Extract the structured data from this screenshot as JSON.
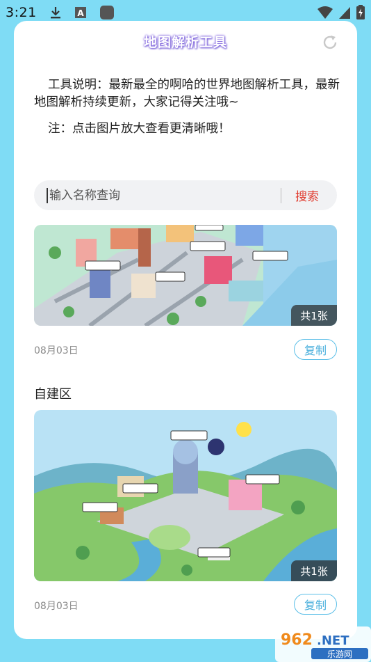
{
  "status": {
    "time": "3:21"
  },
  "header": {
    "title": "地图解析工具"
  },
  "description": {
    "intro": "工具说明：最新最全的啊哈的世界地图解析工具，最新地图解析持续更新，大家记得关注哦~",
    "note": "注：点击图片放大查看更清晰哦！"
  },
  "search": {
    "placeholder": "输入名称查询",
    "button_label": "搜索"
  },
  "items": [
    {
      "title": "",
      "count_label": "共1张",
      "date": "08月03日",
      "copy_label": "复制"
    },
    {
      "title": "自建区",
      "count_label": "共1张",
      "date": "08月03日",
      "copy_label": "复制"
    }
  ],
  "watermark": {
    "brand": "962.NET",
    "sub": "乐游网"
  },
  "colors": {
    "background": "#7fdcf5",
    "accent_blue": "#4bb0dd",
    "search_red": "#e0392c"
  }
}
